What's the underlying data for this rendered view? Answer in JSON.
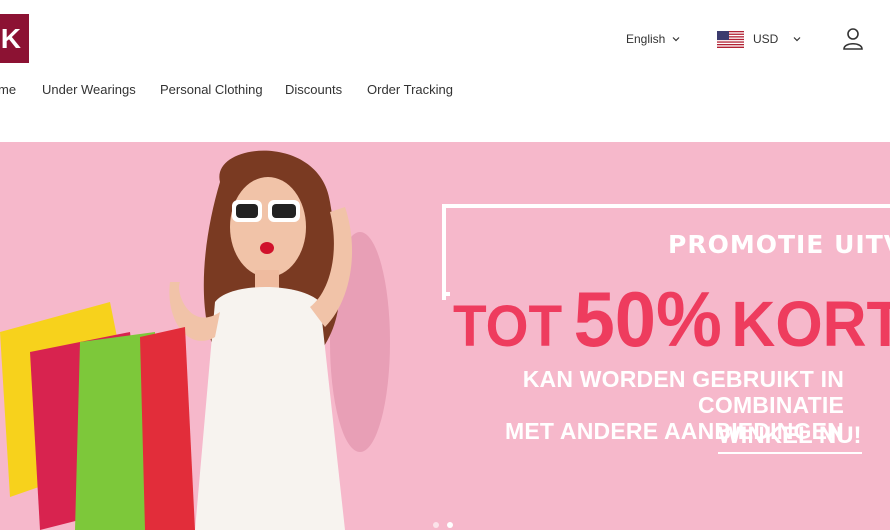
{
  "brand": {
    "logo_text": "K",
    "color": "#8c1233"
  },
  "header": {
    "language": "English",
    "currency": "USD",
    "icons": {
      "language_chevron": "chevron-down-icon",
      "currency_flag": "us-flag-icon",
      "account": "user-icon"
    }
  },
  "nav": {
    "items": [
      {
        "label": "me"
      },
      {
        "label": "Under Wearings"
      },
      {
        "label": "Personal Clothing"
      },
      {
        "label": "Discounts"
      },
      {
        "label": "Order Tracking"
      }
    ]
  },
  "banner": {
    "background": "#f6b8cb",
    "promo_line1": "PROMOTIE UITVERKO",
    "promo_tot": "TOT",
    "promo_pct": "50%",
    "promo_kortin": "KORTIN",
    "promo_line3a": "KAN WORDEN GEBRUIKT IN COMBINATIE",
    "promo_line3b": "MET ANDERE AANBIEDINGEN",
    "cta": "WINKEL NU!",
    "accent": "#ee3c5e"
  }
}
